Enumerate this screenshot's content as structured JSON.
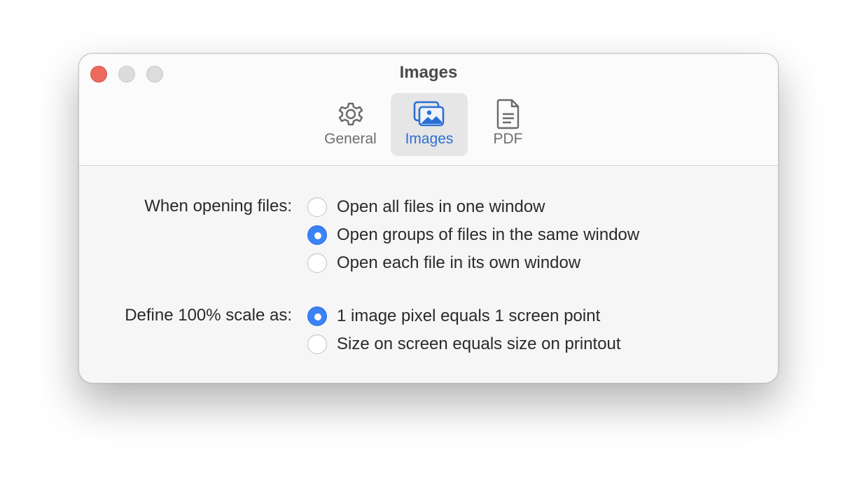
{
  "window": {
    "title": "Images"
  },
  "toolbar": {
    "tabs": [
      {
        "label": "General",
        "icon": "gear-icon",
        "active": false
      },
      {
        "label": "Images",
        "icon": "photos-icon",
        "active": true
      },
      {
        "label": "PDF",
        "icon": "document-icon",
        "active": false
      }
    ]
  },
  "open_files": {
    "label": "When opening files:",
    "options": [
      {
        "label": "Open all files in one window",
        "checked": false
      },
      {
        "label": "Open groups of files in the same window",
        "checked": true
      },
      {
        "label": "Open each file in its own window",
        "checked": false
      }
    ]
  },
  "scale": {
    "label": "Define 100% scale as:",
    "options": [
      {
        "label": "1 image pixel equals 1 screen point",
        "checked": true
      },
      {
        "label": "Size on screen equals size on printout",
        "checked": false
      }
    ]
  },
  "colors": {
    "accent": "#3b82f6",
    "close": "#ed6a5e",
    "active_tab_text": "#2b6fd6"
  }
}
